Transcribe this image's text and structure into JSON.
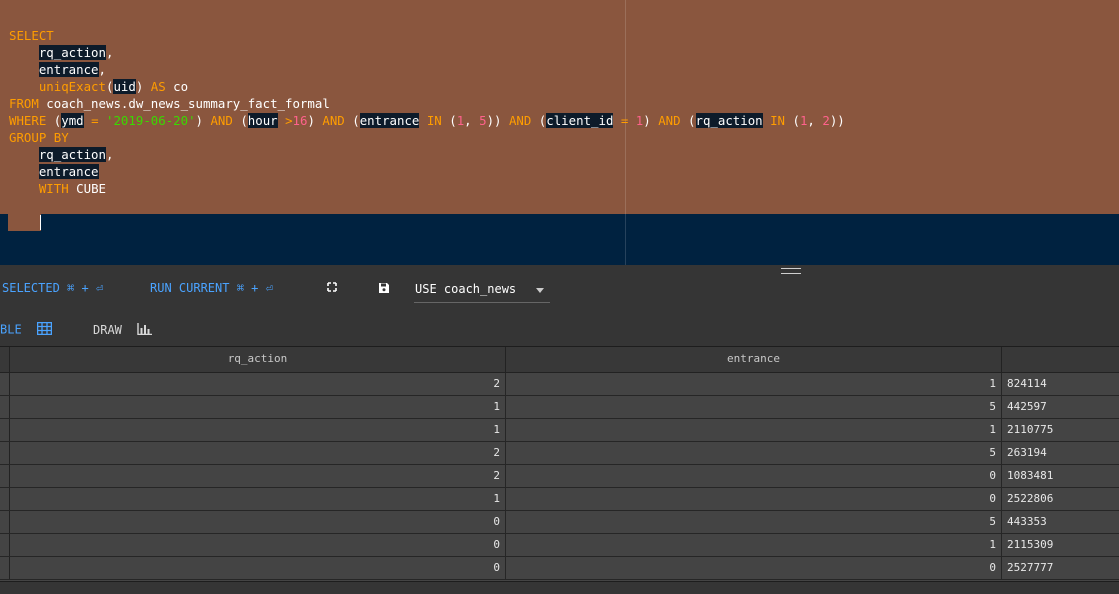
{
  "editor": {
    "lines": [
      [
        {
          "t": "SELECT",
          "c": "kw"
        }
      ],
      [
        {
          "t": "    "
        },
        {
          "t": "rq_action",
          "c": "hl"
        },
        {
          "t": ","
        }
      ],
      [
        {
          "t": "    "
        },
        {
          "t": "entrance",
          "c": "hl"
        },
        {
          "t": ","
        }
      ],
      [
        {
          "t": "    "
        },
        {
          "t": "uniqExact",
          "c": "kw"
        },
        {
          "t": "("
        },
        {
          "t": "uid",
          "c": "hl"
        },
        {
          "t": ") "
        },
        {
          "t": "AS",
          "c": "kw"
        },
        {
          "t": " co"
        }
      ],
      [
        {
          "t": "FROM",
          "c": "kw"
        },
        {
          "t": " coach_news.dw_news_summary_fact_formal"
        }
      ],
      [
        {
          "t": "WHERE",
          "c": "kw"
        },
        {
          "t": " ("
        },
        {
          "t": "ymd",
          "c": "hl"
        },
        {
          "t": " = ",
          "c": "kw"
        },
        {
          "t": "'2019-06-20'",
          "c": "str"
        },
        {
          "t": ") "
        },
        {
          "t": "AND",
          "c": "kw"
        },
        {
          "t": " ("
        },
        {
          "t": "hour",
          "c": "hl"
        },
        {
          "t": " >",
          "c": "kw"
        },
        {
          "t": "16",
          "c": "num"
        },
        {
          "t": ") "
        },
        {
          "t": "AND",
          "c": "kw"
        },
        {
          "t": " ("
        },
        {
          "t": "entrance",
          "c": "hl"
        },
        {
          "t": " IN",
          "c": "kw"
        },
        {
          "t": " ("
        },
        {
          "t": "1",
          "c": "num"
        },
        {
          "t": ", "
        },
        {
          "t": "5",
          "c": "num"
        },
        {
          "t": ")) "
        },
        {
          "t": "AND",
          "c": "kw"
        },
        {
          "t": " ("
        },
        {
          "t": "client_id",
          "c": "hl"
        },
        {
          "t": " = ",
          "c": "kw"
        },
        {
          "t": "1",
          "c": "num"
        },
        {
          "t": ") "
        },
        {
          "t": "AND",
          "c": "kw"
        },
        {
          "t": " ("
        },
        {
          "t": "rq_action",
          "c": "hl"
        },
        {
          "t": " IN",
          "c": "kw"
        },
        {
          "t": " ("
        },
        {
          "t": "1",
          "c": "num"
        },
        {
          "t": ", "
        },
        {
          "t": "2",
          "c": "num"
        },
        {
          "t": "))"
        }
      ],
      [
        {
          "t": "GROUP BY",
          "c": "kw"
        }
      ],
      [
        {
          "t": "    "
        },
        {
          "t": "rq_action",
          "c": "hl"
        },
        {
          "t": ","
        }
      ],
      [
        {
          "t": "    "
        },
        {
          "t": "entrance",
          "c": "hl"
        }
      ],
      [
        {
          "t": "    "
        },
        {
          "t": "WITH",
          "c": "kw"
        },
        {
          "t": " CUBE"
        }
      ]
    ]
  },
  "toolbar": {
    "run_selected": "SELECTED ⌘ + ⏎",
    "run_current": "RUN CURRENT ⌘ + ⏎",
    "database": "USE coach_news"
  },
  "tabs": {
    "table": "BLE",
    "draw": "DRAW"
  },
  "grid": {
    "columns": [
      "rq_action",
      "entrance",
      ""
    ],
    "rows": [
      [
        "2",
        "1",
        "824114"
      ],
      [
        "1",
        "5",
        "442597"
      ],
      [
        "1",
        "1",
        "2110775"
      ],
      [
        "2",
        "5",
        "263194"
      ],
      [
        "2",
        "0",
        "1083481"
      ],
      [
        "1",
        "0",
        "2522806"
      ],
      [
        "0",
        "5",
        "443353"
      ],
      [
        "0",
        "1",
        "2115309"
      ],
      [
        "0",
        "0",
        "2527777"
      ]
    ]
  },
  "colors": {
    "editor_bg": "#002240",
    "selection": "#8a563e",
    "keyword": "#ff9d00",
    "string": "#3ad900",
    "number": "#ff628c",
    "accent": "#4aa3ff"
  }
}
